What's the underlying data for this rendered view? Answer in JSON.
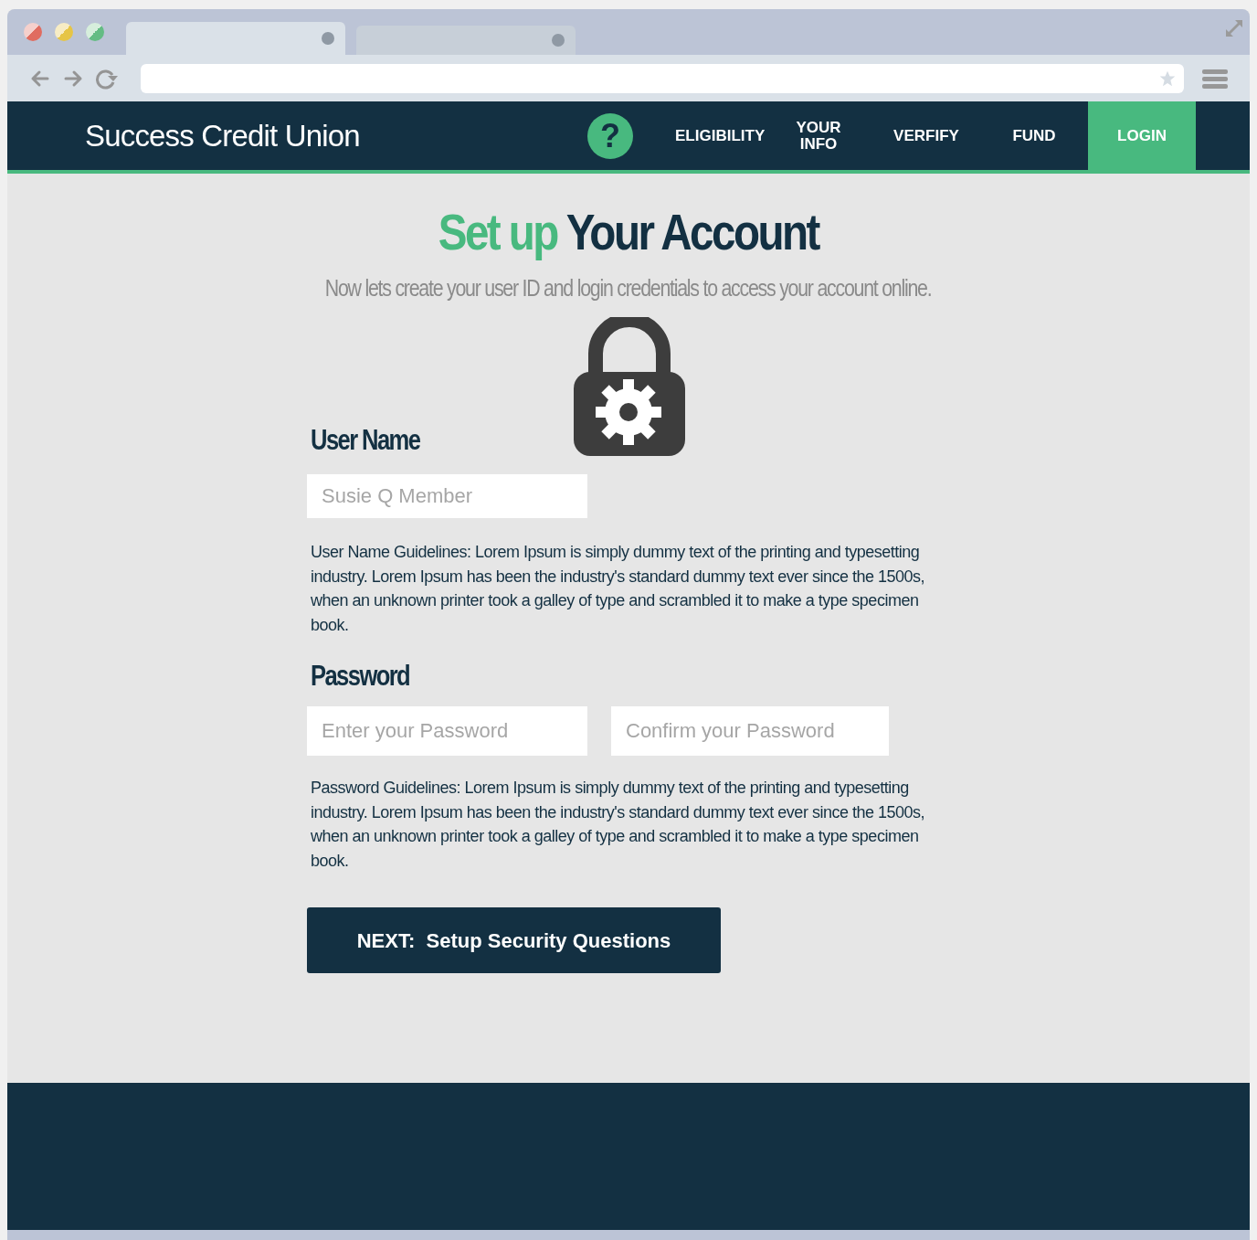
{
  "browser": {
    "tabs": [
      {
        "selected": true
      },
      {
        "selected": false
      }
    ]
  },
  "header": {
    "brand": "Success Credit Union",
    "help": "?",
    "nav": [
      {
        "label": "ELIGIBILITY",
        "selected": false
      },
      {
        "label": "YOUR INFO",
        "selected": false
      },
      {
        "label": "VERFIFY",
        "selected": false
      },
      {
        "label": "FUND",
        "selected": false
      },
      {
        "label": "LOGIN",
        "selected": true
      }
    ]
  },
  "page": {
    "title_highlight": "Set up",
    "title_rest": "Your Account",
    "subtitle": "Now lets create your user ID and login credentials to access your account online.",
    "username": {
      "label": "User Name",
      "placeholder": "Susie Q Member",
      "guidelines": "User Name Guidelines:  Lorem Ipsum is simply dummy text of the printing and typesetting industry. Lorem Ipsum has been the industry's standard dummy text ever since the 1500s, when an unknown printer took a galley of type and scrambled it to make a type specimen book."
    },
    "password": {
      "label": "Password",
      "placeholder": "Enter your Password",
      "confirm_placeholder": "Confirm your Password",
      "guidelines": "Password Guidelines:  Lorem Ipsum is simply dummy text of the printing and typesetting industry. Lorem Ipsum has been the industry's standard dummy text ever since the 1500s, when an unknown printer took a galley of type and scrambled it to make a type specimen book."
    },
    "next_button": "NEXT:  Setup Security Questions"
  }
}
